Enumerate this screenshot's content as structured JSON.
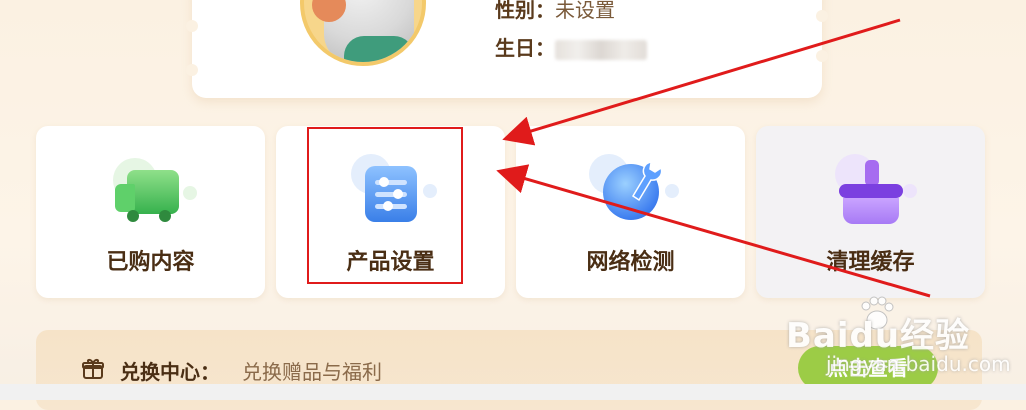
{
  "profile": {
    "gender_label": "性别：",
    "gender_value": "未设置",
    "birthday_label": "生日："
  },
  "tiles": [
    {
      "label": "已购内容",
      "icon": "truck-icon"
    },
    {
      "label": "产品设置",
      "icon": "sliders-icon"
    },
    {
      "label": "网络检测",
      "icon": "network-wrench-icon"
    },
    {
      "label": "清理缓存",
      "icon": "broom-icon"
    }
  ],
  "redeem": {
    "title": "兑换中心：",
    "description": "兑换赠品与福利",
    "button_label": "点击查看"
  },
  "watermark": {
    "logo_text": "Baidu经验",
    "url": "jingyan.baidu.com"
  },
  "colors": {
    "annotation_red": "#e01b1b",
    "brand_brown": "#4a2e14",
    "button_green": "#9ccc46"
  }
}
